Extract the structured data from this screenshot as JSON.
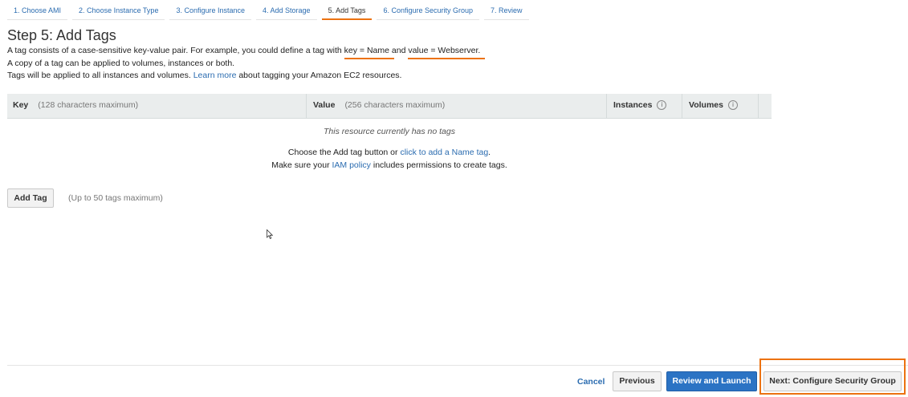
{
  "steps": [
    {
      "label": "1. Choose AMI"
    },
    {
      "label": "2. Choose Instance Type"
    },
    {
      "label": "3. Configure Instance"
    },
    {
      "label": "4. Add Storage"
    },
    {
      "label": "5. Add Tags"
    },
    {
      "label": "6. Configure Security Group"
    },
    {
      "label": "7. Review"
    }
  ],
  "page": {
    "title": "Step 5: Add Tags",
    "desc_line1_a": "A tag consists of a case-sensitive key-value pair. For example, you could define a tag with ",
    "desc_key": "key = Name",
    "desc_and": " and ",
    "desc_value": "value = Webserver.",
    "desc_line2": "A copy of a tag can be applied to volumes, instances or both.",
    "desc_line3_a": "Tags will be applied to all instances and volumes. ",
    "desc_link": "Learn more",
    "desc_line3_b": " about tagging your Amazon EC2 resources."
  },
  "table": {
    "key_header": "Key",
    "key_hint": "(128 characters maximum)",
    "value_header": "Value",
    "value_hint": "(256 characters maximum)",
    "instances_header": "Instances",
    "volumes_header": "Volumes",
    "info_glyph": "i",
    "empty_title": "This resource currently has no tags",
    "empty_line1_a": "Choose the Add tag button or ",
    "empty_line1_link": "click to add a Name tag",
    "empty_line1_b": ".",
    "empty_line2_a": "Make sure your ",
    "empty_line2_link": "IAM policy",
    "empty_line2_b": " includes permissions to create tags."
  },
  "add_tag": {
    "label": "Add Tag",
    "hint": "(Up to 50 tags maximum)"
  },
  "footer": {
    "cancel": "Cancel",
    "previous": "Previous",
    "review": "Review and Launch",
    "next": "Next: Configure Security Group"
  },
  "colors": {
    "accent": "#ec7211",
    "link": "#2b6cb0",
    "primary": "#2b73c4"
  },
  "icons": {
    "cursor": "mouse-pointer-icon",
    "info": "info-icon"
  }
}
